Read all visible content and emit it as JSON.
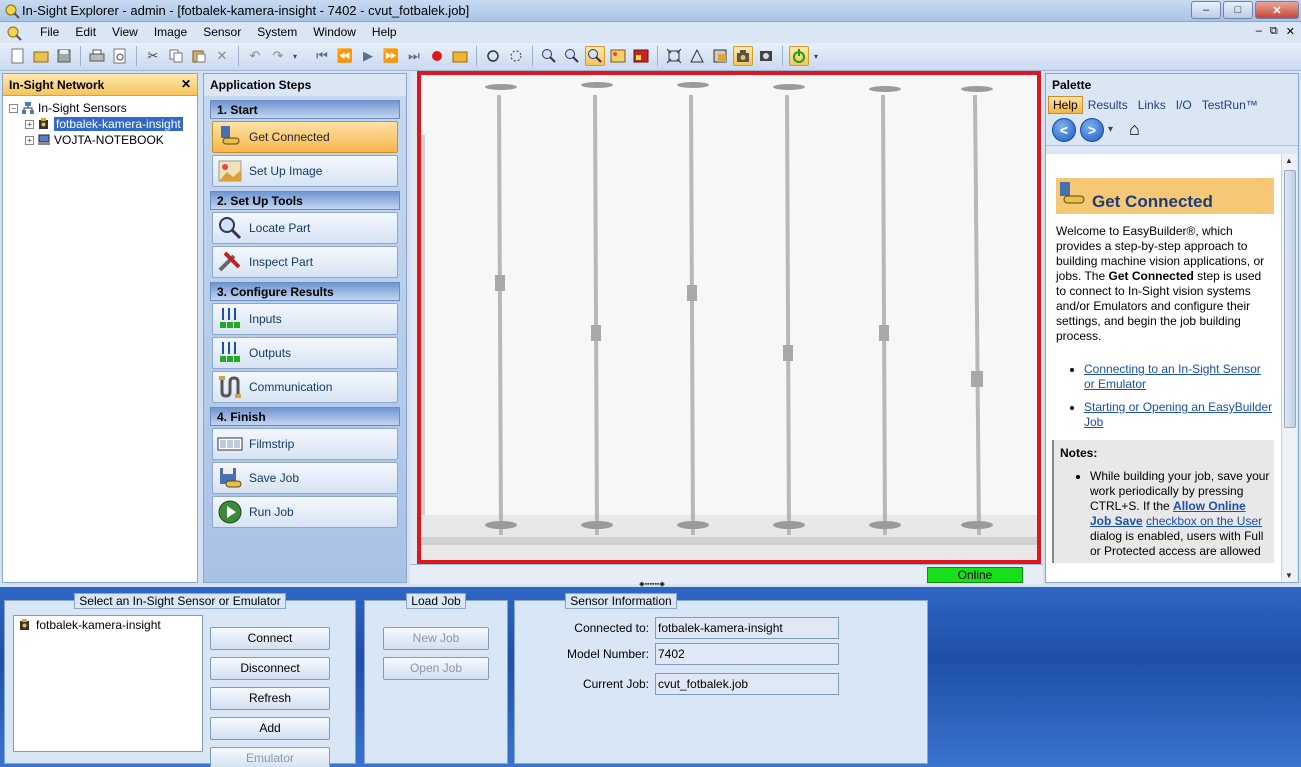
{
  "window": {
    "title": "In-Sight Explorer - admin - [fotbalek-kamera-insight - 7402 - cvut_fotbalek.job]",
    "controls": {
      "minimize": "–",
      "maximize": "□",
      "close": "✕"
    }
  },
  "menu": {
    "items": [
      "File",
      "Edit",
      "View",
      "Image",
      "Sensor",
      "System",
      "Window",
      "Help"
    ],
    "mdi_controls": {
      "minimize": "–",
      "restore": "⧉",
      "close": "✕"
    }
  },
  "toolbar": {
    "icons": [
      "new-icon",
      "open-icon",
      "save-icon",
      "print-icon",
      "print-preview-icon",
      "cut-icon",
      "copy-icon",
      "paste-icon",
      "delete-icon",
      "undo-icon",
      "redo-icon",
      "first-frame-icon",
      "prev-frame-icon",
      "play-icon",
      "next-frame-icon",
      "last-frame-icon",
      "record-icon",
      "folder-icon",
      "circle-icon",
      "circle-dashed-icon",
      "zoom-in-icon",
      "zoom-out-icon",
      "zoom-fit-icon",
      "image-icon",
      "image-color-icon",
      "fit-screen-icon",
      "graphics-icon",
      "tool-icon",
      "camera-icon",
      "trigger-icon",
      "online-icon"
    ]
  },
  "network": {
    "title": "In-Sight Network",
    "close": "✕",
    "tree": [
      {
        "label": "In-Sight Sensors",
        "expander": "−",
        "indent": 0
      },
      {
        "label": "fotbalek-kamera-insight",
        "expander": "+",
        "indent": 1,
        "selected": true
      },
      {
        "label": "VOJTA-NOTEBOOK",
        "expander": "+",
        "indent": 1
      }
    ]
  },
  "steps": {
    "title": "Application Steps",
    "sections": [
      {
        "title": "1. Start",
        "items": [
          "Get Connected",
          "Set Up Image"
        ]
      },
      {
        "title": "2. Set Up Tools",
        "items": [
          "Locate Part",
          "Inspect Part"
        ]
      },
      {
        "title": "3. Configure Results",
        "items": [
          "Inputs",
          "Outputs",
          "Communication"
        ]
      },
      {
        "title": "4. Finish",
        "items": [
          "Filmstrip",
          "Save Job",
          "Run Job"
        ]
      }
    ],
    "active": "Get Connected"
  },
  "image": {
    "status": "Online",
    "status_color": "#17e01a",
    "frame_color": "#e0141c"
  },
  "palette": {
    "title": "Palette",
    "tabs": [
      "Help",
      "Results",
      "Links",
      "I/O",
      "TestRun™"
    ],
    "active_tab": "Help",
    "nav": {
      "back": "<",
      "forward": ">",
      "dropdown": "▾",
      "home": "⌂"
    },
    "help": {
      "heading": "Get Connected",
      "intro_a": "Welcome to EasyBuilder®, which provides a step-by-step approach to building machine vision applications, or jobs. The ",
      "intro_bold": "Get Connected",
      "intro_b": " step is used to connect to In-Sight vision systems and/or Emulators and configure their settings, and begin the job building process.",
      "links": [
        "Connecting to an In-Sight Sensor or Emulator",
        "Starting or Opening an EasyBuilder Job"
      ],
      "notes_title": "Notes:",
      "note_a": "While building your job, save your work periodically by pressing CTRL+S. If the ",
      "note_link_bold": "Allow Online Job Save",
      "note_link": "checkbox on the User",
      "note_b": " dialog is enabled, users with Full or Protected access are allowed"
    }
  },
  "bottom": {
    "select_group": {
      "title": "Select an In-Sight Sensor or Emulator",
      "list": [
        "fotbalek-kamera-insight"
      ],
      "buttons": [
        "Connect",
        "Disconnect",
        "Refresh",
        "Add",
        "Emulator"
      ]
    },
    "load_group": {
      "title": "Load Job",
      "buttons": [
        "New Job",
        "Open Job"
      ]
    },
    "info_group": {
      "title": "Sensor Information",
      "fields": [
        {
          "label": "Connected to:",
          "value": "fotbalek-kamera-insight"
        },
        {
          "label": "Model Number:",
          "value": "7402"
        },
        {
          "label": "Current Job:",
          "value": "cvut_fotbalek.job"
        }
      ]
    }
  }
}
